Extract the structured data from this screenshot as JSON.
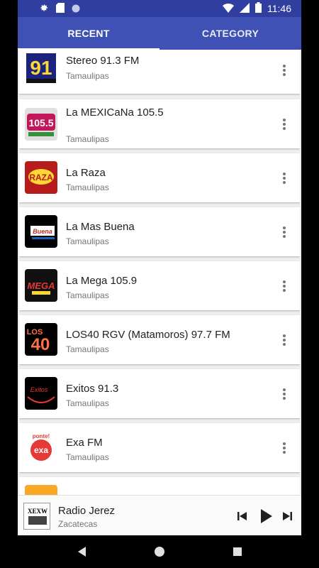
{
  "status_bar": {
    "time": "11:46",
    "left_icons": [
      "settings-icon",
      "sd-card-icon",
      "circle-icon"
    ],
    "right_icons": [
      "wifi-icon",
      "signal-icon",
      "battery-icon"
    ]
  },
  "tabs": [
    {
      "label": "RECENT",
      "active": true
    },
    {
      "label": "CATEGORY",
      "active": false
    }
  ],
  "stations": [
    {
      "name": "Stereo 91.3 FM",
      "region": "Tamaulipas",
      "logo_text": "91",
      "logo_icon": "stereo91-logo"
    },
    {
      "name": "La MEXICaNa 105.5",
      "region": "Tamaulipas",
      "logo_text": "105.5",
      "logo_icon": "la-mexicana-logo"
    },
    {
      "name": "La Raza",
      "region": "Tamaulipas",
      "logo_text": "RAZA",
      "logo_icon": "la-raza-logo"
    },
    {
      "name": "La Mas Buena",
      "region": "Tamaulipas",
      "logo_text": "Buena",
      "logo_icon": "la-mas-buena-logo"
    },
    {
      "name": "La Mega 105.9",
      "region": "Tamaulipas",
      "logo_text": "MEGA",
      "logo_icon": "la-mega-logo"
    },
    {
      "name": "LOS40 RGV (Matamoros) 97.7 FM",
      "region": "Tamaulipas",
      "logo_text": "40",
      "logo_icon": "los40-logo"
    },
    {
      "name": "Exitos 91.3",
      "region": "Tamaulipas",
      "logo_text": "Exitos",
      "logo_icon": "exitos-logo"
    },
    {
      "name": "Exa FM",
      "region": "Tamaulipas",
      "logo_text": "exa",
      "logo_icon": "exa-fm-logo"
    }
  ],
  "now_playing": {
    "name": "Radio Jerez",
    "region": "Zacatecas",
    "logo_text": "XEXW",
    "controls": [
      "skip-previous-icon",
      "play-icon",
      "skip-next-icon"
    ]
  },
  "nav_bar": {
    "buttons": [
      "back-icon",
      "home-icon",
      "recents-icon"
    ]
  },
  "colors": {
    "status_bar": "#303f9f",
    "tab_bar": "#3f51b5",
    "background": "#eeeeee"
  }
}
